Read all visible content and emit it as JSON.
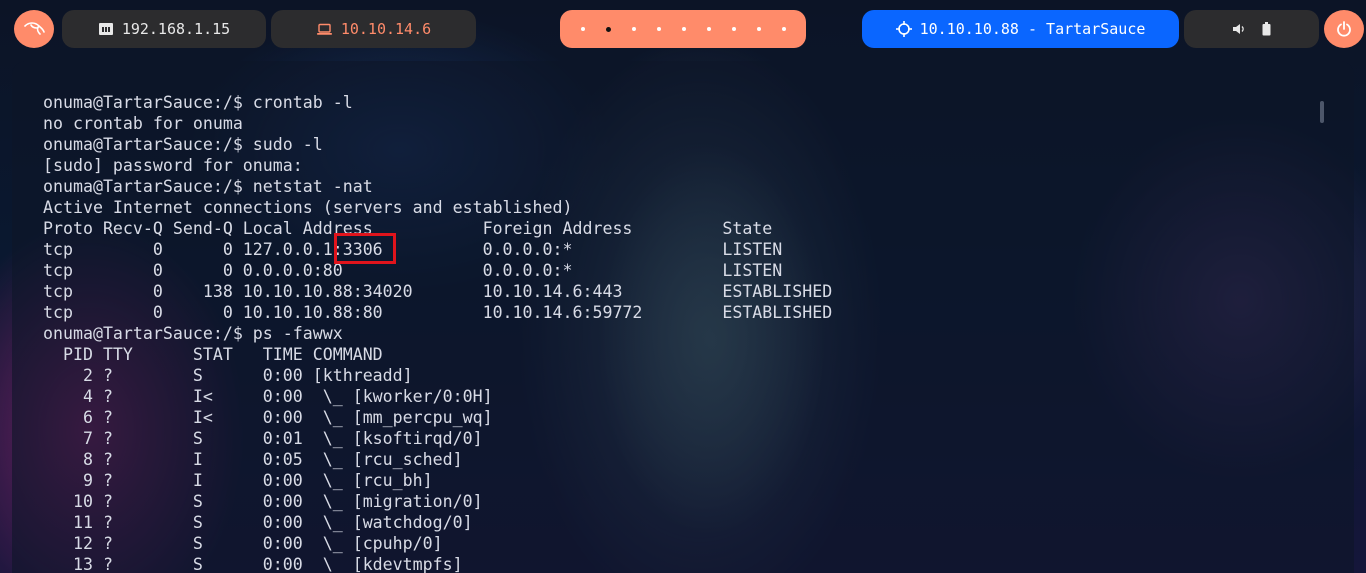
{
  "topbar": {
    "kali_icon": "kali-dragon-icon",
    "host_ip": "192.168.1.15",
    "host_icon": "network-card-icon",
    "vpn_ip": "10.10.14.6",
    "vpn_icon": "laptop-icon",
    "workspaces": {
      "count": 9,
      "active_index": 1
    },
    "target": "10.10.10.88 - TartarSauce",
    "target_icon": "crosshair-icon",
    "tray_icons": [
      "volume-icon",
      "battery-icon"
    ],
    "power_icon": "power-icon",
    "colors": {
      "accent": "#ff8b6a",
      "target_bg": "#0a66ff",
      "pill_bg": "#2c2c2e"
    }
  },
  "terminal": {
    "lines": [
      "onuma@TartarSauce:/$ crontab -l",
      "no crontab for onuma",
      "onuma@TartarSauce:/$ sudo -l",
      "[sudo] password for onuma:",
      "onuma@TartarSauce:/$ netstat -nat",
      "Active Internet connections (servers and established)",
      "Proto Recv-Q Send-Q Local Address           Foreign Address         State",
      "tcp        0      0 127.0.0.1:3306          0.0.0.0:*               LISTEN",
      "tcp        0      0 0.0.0.0:80              0.0.0.0:*               LISTEN",
      "tcp        0    138 10.10.10.88:34020       10.10.14.6:443          ESTABLISHED",
      "tcp        0      0 10.10.10.88:80          10.10.14.6:59772        ESTABLISHED",
      "onuma@TartarSauce:/$ ps -fawwx",
      "  PID TTY      STAT   TIME COMMAND",
      "    2 ?        S      0:00 [kthreadd]",
      "    4 ?        I<     0:00  \\_ [kworker/0:0H]",
      "    6 ?        I<     0:00  \\_ [mm_percpu_wq]",
      "    7 ?        S      0:01  \\_ [ksoftirqd/0]",
      "    8 ?        I      0:05  \\_ [rcu_sched]",
      "    9 ?        I      0:00  \\_ [rcu_bh]",
      "   10 ?        S      0:00  \\_ [migration/0]",
      "   11 ?        S      0:00  \\_ [watchdog/0]",
      "   12 ?        S      0:00  \\_ [cpuhp/0]",
      "   13 ?        S      0:00  \\_ [kdevtmpfs]"
    ],
    "highlight_color": "#e0141c"
  }
}
